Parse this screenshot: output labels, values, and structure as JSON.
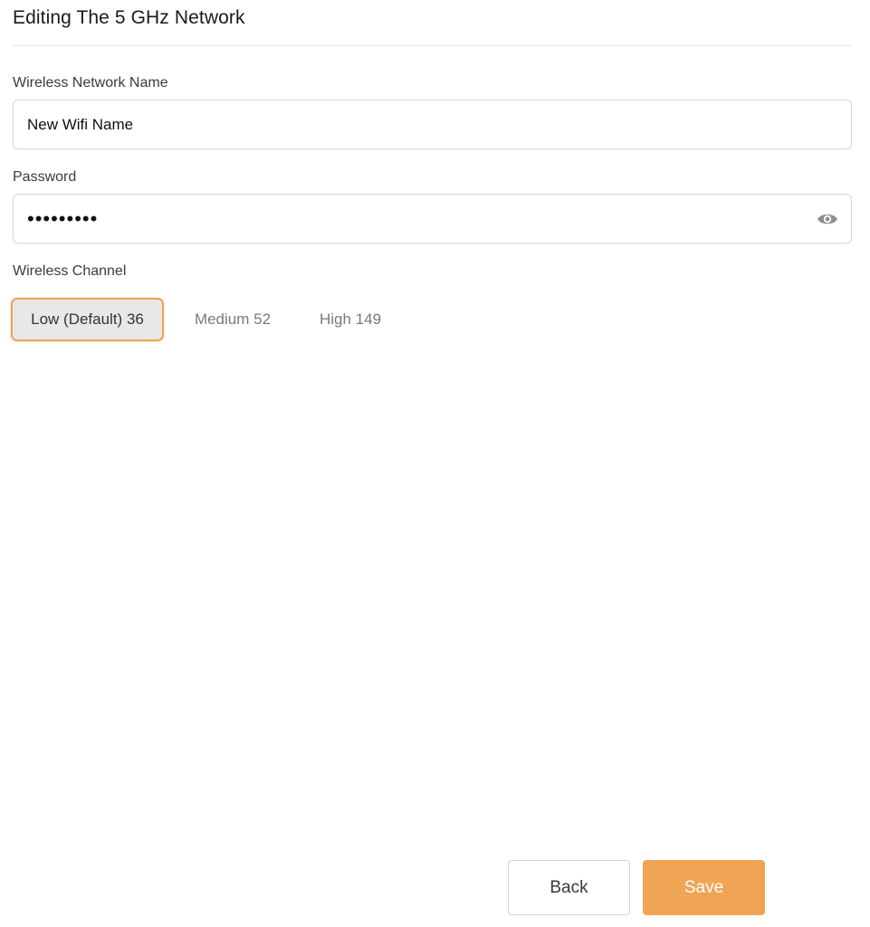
{
  "header": {
    "title": "Editing The 5 GHz Network"
  },
  "form": {
    "network_name": {
      "label": "Wireless Network Name",
      "value": "New Wifi Name"
    },
    "password": {
      "label": "Password",
      "value": "•••••••••",
      "toggle_icon": "eye-icon"
    },
    "channel": {
      "label": "Wireless Channel",
      "options": [
        {
          "label": "Low (Default) 36",
          "selected": true
        },
        {
          "label": "Medium 52",
          "selected": false
        },
        {
          "label": "High 149",
          "selected": false
        }
      ]
    }
  },
  "actions": {
    "back_label": "Back",
    "save_label": "Save"
  },
  "colors": {
    "accent": "#f0a555",
    "selected_bg": "#e8e8e8",
    "border": "#d9d9d9"
  }
}
